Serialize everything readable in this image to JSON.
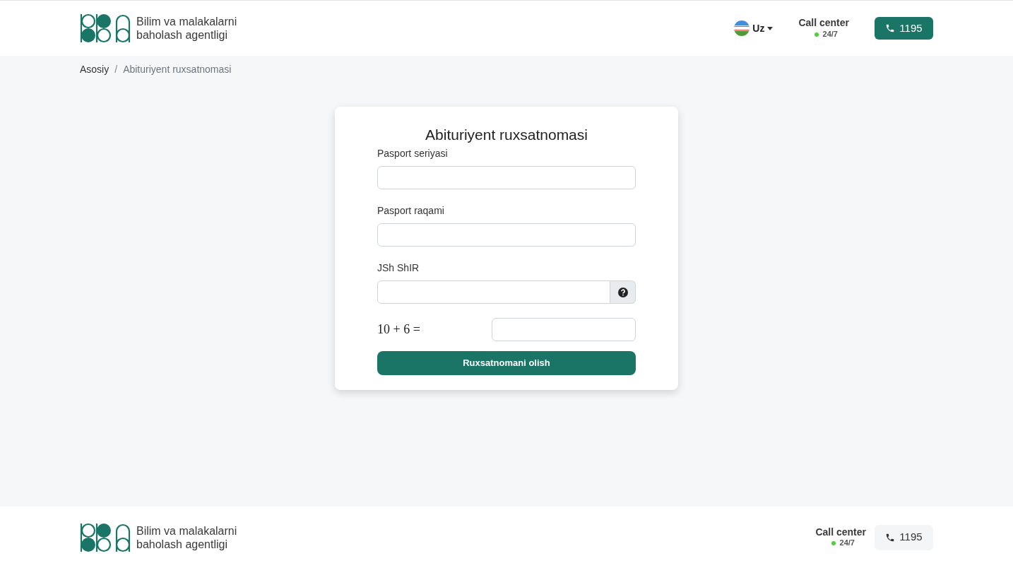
{
  "header": {
    "org_name_line1": "Bilim va malakalarni",
    "org_name_line2": "baholash agentligi",
    "language": "Uz",
    "call_center": {
      "label": "Call center",
      "hours": "24/7"
    },
    "phone": "1195"
  },
  "breadcrumb_separator": "/",
  "breadcrumbs": [
    {
      "label": "Asosiy"
    },
    {
      "label": "Abituriyent ruxsatnomasi"
    }
  ],
  "form": {
    "title": "Abituriyent ruxsatnomasi",
    "fields": [
      {
        "label": "Pasport seriyasi",
        "kind": "text"
      },
      {
        "label": "Pasport raqami",
        "kind": "text"
      },
      {
        "label": "JSh ShIR",
        "kind": "help"
      }
    ],
    "captcha": "10 + 6 =",
    "submit": "Ruxsatnomani olish"
  },
  "footer": {
    "org_name_line1": "Bilim va malakalarni",
    "org_name_line2": "baholash agentligi",
    "call_center": {
      "label": "Call center",
      "hours": "24/7"
    },
    "phone": "1195"
  }
}
